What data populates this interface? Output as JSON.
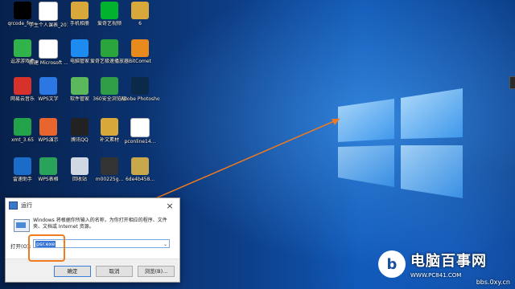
{
  "desktop": {
    "icons": [
      {
        "label": "qrcode_for...",
        "icon": "qr-code-icon",
        "color": "#000000"
      },
      {
        "label": "学生个人课表_20160135...",
        "icon": "document-icon",
        "color": "#ffffff"
      },
      {
        "label": "手机相册",
        "icon": "folder-icon",
        "color": "#d8a83a"
      },
      {
        "label": "爱奇艺视频",
        "icon": "iqiyi-icon",
        "color": "#00b22d"
      },
      {
        "label": "6",
        "icon": "folder-icon",
        "color": "#d8a83a"
      },
      {
        "label": "逗游游戏盒",
        "icon": "game-box-icon",
        "color": "#2fb34a"
      },
      {
        "label": "新建 Microsoft ...",
        "icon": "document-icon",
        "color": "#ffffff"
      },
      {
        "label": "电脑管家",
        "icon": "shield-icon",
        "color": "#1e8bf0"
      },
      {
        "label": "爱奇艺极速播放器",
        "icon": "player-icon",
        "color": "#2aa53c"
      },
      {
        "label": "BitComet",
        "icon": "bitcomet-icon",
        "color": "#e98a1d"
      },
      {
        "label": "网易云音乐",
        "icon": "netease-music-icon",
        "color": "#d6322b"
      },
      {
        "label": "WPS文字",
        "icon": "wps-writer-icon",
        "color": "#2b78e4"
      },
      {
        "label": "软件管家",
        "icon": "software-manager-icon",
        "color": "#5cb85c"
      },
      {
        "label": "360安全浏览器",
        "icon": "browser-icon",
        "color": "#2f9d46"
      },
      {
        "label": "Adobe Photosho...",
        "icon": "photoshop-icon",
        "color": "#0b2a4a"
      },
      {
        "label": "xmt_3.65",
        "icon": "app-icon",
        "color": "#22a34a"
      },
      {
        "label": "WPS演示",
        "icon": "wps-presentation-icon",
        "color": "#e8652d"
      },
      {
        "label": "腾讯QQ",
        "icon": "qq-icon",
        "color": "#222222"
      },
      {
        "label": "补文素材",
        "icon": "folder-icon",
        "color": "#d8a83a"
      },
      {
        "label": "pconline14...",
        "icon": "document-icon",
        "color": "#ffffff"
      },
      {
        "label": "雷速助手",
        "icon": "helper-icon",
        "color": "#1b6bc9"
      },
      {
        "label": "WPS表格",
        "icon": "wps-spreadsheet-icon",
        "color": "#29a35a"
      },
      {
        "label": "回收站",
        "icon": "recycle-bin-icon",
        "color": "#cfd8e3"
      },
      {
        "label": "m00225g...",
        "icon": "image-file-icon",
        "color": "#333333"
      },
      {
        "label": "6de4b458...",
        "icon": "image-file-icon",
        "color": "#c9a84b"
      }
    ]
  },
  "run_dialog": {
    "title": "运行",
    "close_glyph": "×",
    "description": "Windows 将根据你所输入的名称，为你打开相应的程序、文件夹、文档或 Internet 资源。",
    "open_label": "打开(O):",
    "input_value": "psr.exe",
    "dropdown_glyph": "⌄",
    "buttons": {
      "ok": "确定",
      "cancel": "取消",
      "browse": "浏览(B)..."
    }
  },
  "watermark": {
    "logo_glyph": "b",
    "main_text": "电脑百事网",
    "sub_text": "WWW.PC841.COM",
    "url_text": "bbs.0xy.cn"
  },
  "colors": {
    "highlight": "#f07a1f",
    "selection": "#3875d7"
  }
}
